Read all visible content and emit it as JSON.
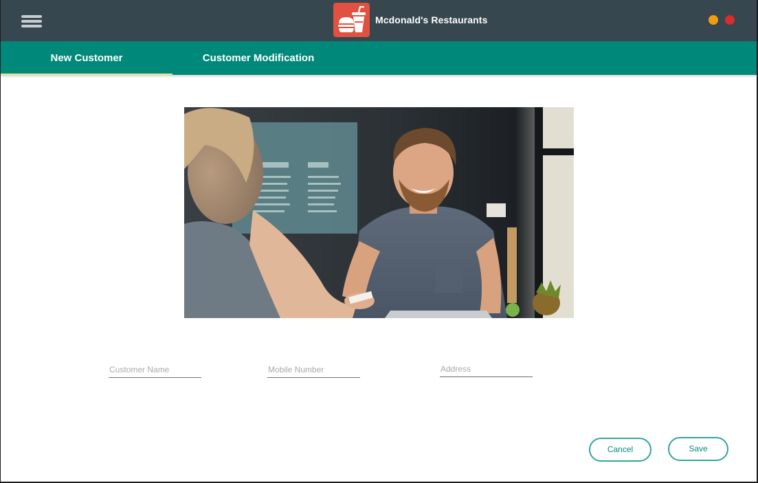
{
  "window": {
    "title": "Mcdonald's Restaurants",
    "logo_icon": "burger-and-drink-icon",
    "menu_icon": "hamburger-menu-icon",
    "controls": [
      {
        "name": "minimize",
        "color": "#f39c12"
      },
      {
        "name": "close",
        "color": "#d92c2c"
      }
    ]
  },
  "colors": {
    "titlebar": "#37474f",
    "tabbar": "#00897b",
    "tab_indicator": "#e8e28c",
    "accent": "#2fa59a",
    "logo_bg": "#e15041"
  },
  "tabs": [
    {
      "label": "New Customer",
      "active": true
    },
    {
      "label": "Customer Modification",
      "active": false
    }
  ],
  "form": {
    "customer_name": {
      "placeholder": "Customer Name",
      "value": ""
    },
    "mobile_number": {
      "placeholder": "Mobile Number",
      "value": ""
    },
    "address": {
      "placeholder": "Address",
      "value": ""
    }
  },
  "actions": {
    "cancel_label": "Cancel",
    "save_label": "Save"
  }
}
